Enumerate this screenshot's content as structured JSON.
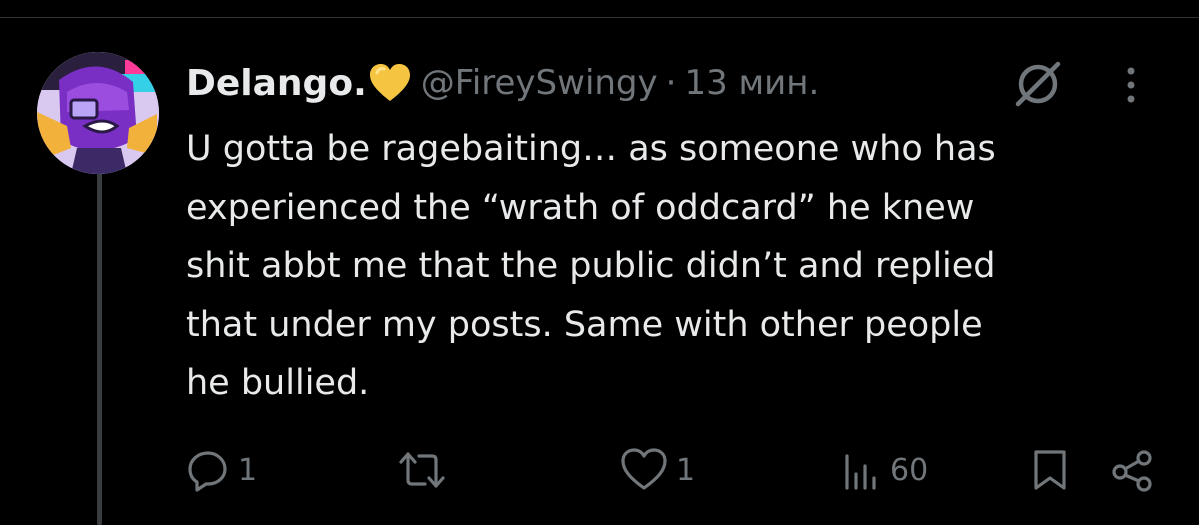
{
  "author": {
    "display_name": "Delango.",
    "handle": "@FireySwingy",
    "separator": "·",
    "time": "13 мин."
  },
  "tweet": {
    "text": "U gotta be ragebaiting… as someone who has\nexperienced the “wrath of oddcard” he knew\nshit abbt me that the public didn’t and replied\nthat under my posts. Same with other people\nhe bullied."
  },
  "actions": {
    "replies": "1",
    "retweets": "",
    "likes": "1",
    "views": "60"
  },
  "colors": {
    "background": "#000000",
    "text_primary": "#e7e9ea",
    "text_secondary": "#71767b",
    "heart": "#f5c542",
    "thread_line": "#3a3d40"
  },
  "icons": [
    "heart-emoji-icon",
    "grok-icon",
    "more-icon",
    "reply-icon",
    "retweet-icon",
    "like-icon",
    "views-icon",
    "bookmark-icon",
    "share-icon"
  ]
}
